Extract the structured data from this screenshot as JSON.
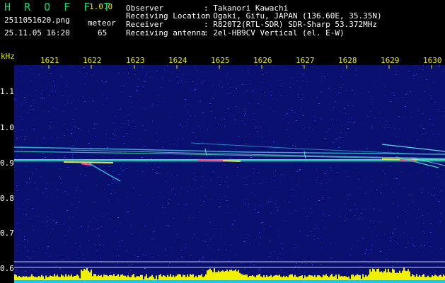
{
  "header": {
    "app_name": "H R O F F T",
    "version": "1.0.0",
    "filename": "2511051620.png",
    "mode": "meteor",
    "datetime": "25.11.05 16:20",
    "count": "65",
    "info_labels": [
      "Observer",
      "Receiving Location",
      "Receiver",
      "Receiving antenna"
    ],
    "info_values": [
      ": Takanori Kawachi",
      ": Ogaki, Gifu, JAPAN (136.60E, 35.35N)",
      ": R820T2(RTL-SDR) SDR-Sharp 53.372MHz",
      ": 2el-HB9CV Vertical (el. E-W)"
    ]
  },
  "x_axis": {
    "ticks": [
      "1621",
      "1622",
      "1623",
      "1624",
      "1625",
      "1626",
      "1627",
      "1628",
      "1629",
      "1630"
    ]
  },
  "y_axis": {
    "unit": "kHz",
    "ticks": [
      "1.1",
      "1.0",
      "0.9",
      "0.8",
      "0.7",
      "0.6"
    ]
  },
  "colors": {
    "background": "#000000",
    "spectrogram_bg": "#0a1070",
    "tick_label": "#e8e800",
    "logo": "#00e070",
    "power_bar": "#f0f000",
    "power_bar_base": "#20c8f0"
  }
}
